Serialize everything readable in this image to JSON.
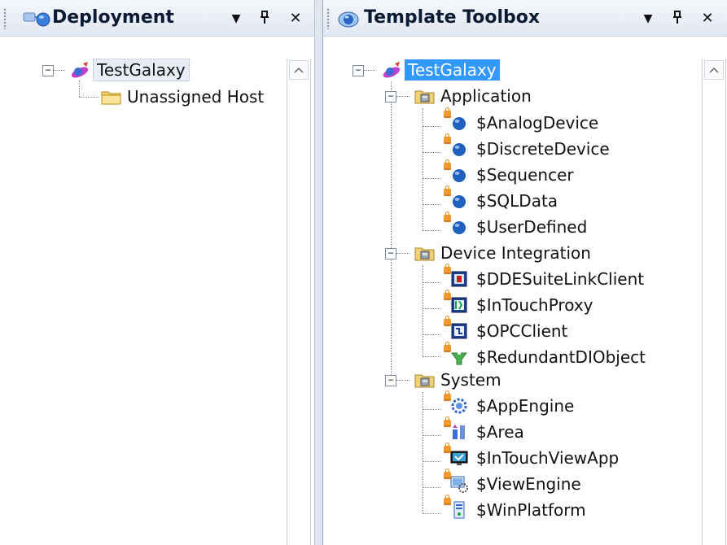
{
  "deployment": {
    "title": "Deployment",
    "buttons": {
      "dropdown": "▼",
      "pin": "ꟸ",
      "close": "✕"
    },
    "tree": [
      {
        "label": "TestGalaxy",
        "icon": "galaxy-icon",
        "expander": "−"
      },
      {
        "label": "Unassigned Host",
        "icon": "folder-icon"
      }
    ]
  },
  "toolbox": {
    "title": "Template Toolbox",
    "buttons": {
      "dropdown": "▼",
      "pin": "ꟸ",
      "close": "✕"
    },
    "root": {
      "label": "TestGalaxy",
      "icon": "galaxy-icon",
      "expander": "−"
    },
    "groups": [
      {
        "label": "Application",
        "icon": "toolset-folder-icon",
        "expander": "−",
        "items": [
          {
            "label": "$AnalogDevice",
            "icon": "blue-sphere-icon"
          },
          {
            "label": "$DiscreteDevice",
            "icon": "blue-sphere-icon"
          },
          {
            "label": "$Sequencer",
            "icon": "blue-sphere-icon"
          },
          {
            "label": "$SQLData",
            "icon": "blue-sphere-icon"
          },
          {
            "label": "$UserDefined",
            "icon": "blue-sphere-icon"
          }
        ]
      },
      {
        "label": "Device Integration",
        "icon": "toolset-folder-icon",
        "expander": "−",
        "items": [
          {
            "label": "$DDESuiteLinkClient",
            "icon": "dde-client-icon"
          },
          {
            "label": "$InTouchProxy",
            "icon": "intouch-proxy-icon"
          },
          {
            "label": "$OPCClient",
            "icon": "opc-client-icon"
          },
          {
            "label": "$RedundantDIObject",
            "icon": "redundant-di-icon"
          }
        ]
      },
      {
        "label": "System",
        "icon": "toolset-folder-icon",
        "expander": "−",
        "items": [
          {
            "label": "$AppEngine",
            "icon": "gear-engine-icon"
          },
          {
            "label": "$Area",
            "icon": "area-icon"
          },
          {
            "label": "$InTouchViewApp",
            "icon": "intouch-viewapp-icon"
          },
          {
            "label": "$ViewEngine",
            "icon": "view-engine-icon"
          },
          {
            "label": "$WinPlatform",
            "icon": "win-platform-icon"
          }
        ]
      }
    ]
  },
  "colors": {
    "selection": "#3399ff",
    "titlebar": "#e2e8f2",
    "lock": "#f39a2b"
  }
}
